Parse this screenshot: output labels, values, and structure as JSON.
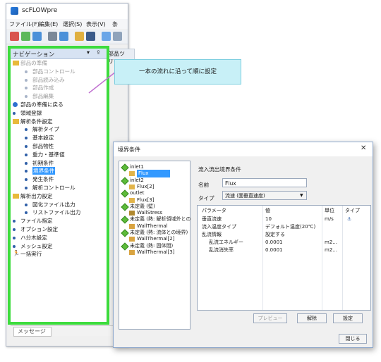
{
  "app": {
    "title": "scFLOWpre"
  },
  "menu": [
    "ファイル(F)",
    "編集(E)",
    "選択(S)",
    "表示(V)",
    "条"
  ],
  "navigation": {
    "title": "ナビゲーション",
    "pin": "▾ ⇪",
    "items": [
      {
        "label": "部品の準備",
        "level": 0,
        "dim": true,
        "icon": "folder"
      },
      {
        "label": "部品コントロール",
        "level": 1,
        "dim": true,
        "icon": "dot"
      },
      {
        "label": "部品読み込み",
        "level": 1,
        "dim": true,
        "icon": "dot"
      },
      {
        "label": "部品作成",
        "level": 1,
        "dim": true,
        "icon": "dot"
      },
      {
        "label": "部品編集",
        "level": 1,
        "dim": true,
        "icon": "dot"
      },
      {
        "label": "部品の準備に戻る",
        "level": 0,
        "icon": "back"
      },
      {
        "label": "領域登録",
        "level": 0,
        "icon": "dot"
      },
      {
        "label": "解析条件設定",
        "level": 0,
        "icon": "folder"
      },
      {
        "label": "解析タイプ",
        "level": 1,
        "icon": "dot"
      },
      {
        "label": "基本設定",
        "level": 1,
        "icon": "dot"
      },
      {
        "label": "部品物性",
        "level": 1,
        "icon": "dot"
      },
      {
        "label": "重力・基準値",
        "level": 1,
        "icon": "dot"
      },
      {
        "label": "初期条件",
        "level": 1,
        "icon": "dot"
      },
      {
        "label": "境界条件",
        "level": 1,
        "icon": "dot",
        "selected": true
      },
      {
        "label": "発生条件",
        "level": 1,
        "icon": "dot"
      },
      {
        "label": "解析コントロール",
        "level": 1,
        "icon": "dot"
      },
      {
        "label": "解析出力設定",
        "level": 0,
        "icon": "folder"
      },
      {
        "label": "図化ファイル出力",
        "level": 1,
        "icon": "dot"
      },
      {
        "label": "リストファイル出力",
        "level": 1,
        "icon": "dot"
      },
      {
        "label": "ファイル指定",
        "level": 0,
        "icon": "dot"
      },
      {
        "label": "オプション設定",
        "level": 0,
        "icon": "dot"
      },
      {
        "label": "ハ分木設定",
        "level": 0,
        "icon": "dot"
      },
      {
        "label": "メッシュ設定",
        "level": 0,
        "icon": "dot"
      },
      {
        "label": "一括実行",
        "level": 0,
        "icon": "run"
      }
    ]
  },
  "parts_tree": {
    "label": "部品ツリー"
  },
  "message_tab": {
    "label": "メッセージ"
  },
  "callout": {
    "text": "一本の流れに沿って順に設定"
  },
  "dialog": {
    "title": "境界条件",
    "close": "✕",
    "tree": [
      {
        "label": "inlet1",
        "level": 0,
        "icon": "diamond"
      },
      {
        "label": "Flux",
        "level": 1,
        "icon": "flux",
        "selected": true
      },
      {
        "label": "inlet2",
        "level": 0,
        "icon": "diamond"
      },
      {
        "label": "Flux[2]",
        "level": 1,
        "icon": "flux"
      },
      {
        "label": "outlet",
        "level": 0,
        "icon": "diamond"
      },
      {
        "label": "Flux[3]",
        "level": 1,
        "icon": "flux"
      },
      {
        "label": "未定義 (壁)",
        "level": 0,
        "icon": "diamond"
      },
      {
        "label": "WallStress",
        "level": 1,
        "icon": "wall"
      },
      {
        "label": "未定義 (熱: 解析領域外との",
        "level": 0,
        "icon": "diamond"
      },
      {
        "label": "WallThermal",
        "level": 1,
        "icon": "thermal"
      },
      {
        "label": "未定義 (熱: 流体との境界)",
        "level": 0,
        "icon": "diamond"
      },
      {
        "label": "WallThermal[2]",
        "level": 1,
        "icon": "thermal"
      },
      {
        "label": "未定義 (熱: 固体間)",
        "level": 0,
        "icon": "diamond"
      },
      {
        "label": "WallThermal[3]",
        "level": 1,
        "icon": "thermal"
      }
    ],
    "section_title": "流入流出境界条件",
    "name_label": "名前",
    "name_value": "Flux",
    "type_label": "タイプ",
    "type_value": "流速 (面垂直速度)",
    "table": {
      "headers": [
        "パラメータ",
        "値",
        "単位",
        "タイプ"
      ],
      "rows": [
        {
          "param": "垂直流速",
          "value": "10",
          "unit": "m/s",
          "type": "⚓",
          "indent": 0
        },
        {
          "param": "流入温度タイプ",
          "value": "デフォルト温度(20℃)",
          "unit": "",
          "type": "",
          "indent": 0
        },
        {
          "param": "乱流情報",
          "value": "設定する",
          "unit": "",
          "type": "",
          "indent": 0
        },
        {
          "param": "乱流エネルギー",
          "value": "0.0001",
          "unit": "m2...",
          "type": "",
          "indent": 1
        },
        {
          "param": "乱流消失率",
          "value": "0.0001",
          "unit": "m2...",
          "type": "",
          "indent": 1
        }
      ]
    },
    "buttons": {
      "preview": "プレビュー",
      "release": "解除",
      "setting": "設定",
      "close": "閉じる"
    }
  },
  "colors": {
    "highlight": "#3ddc3d",
    "callout": "#c8f0f7",
    "selection": "#3399ff"
  }
}
